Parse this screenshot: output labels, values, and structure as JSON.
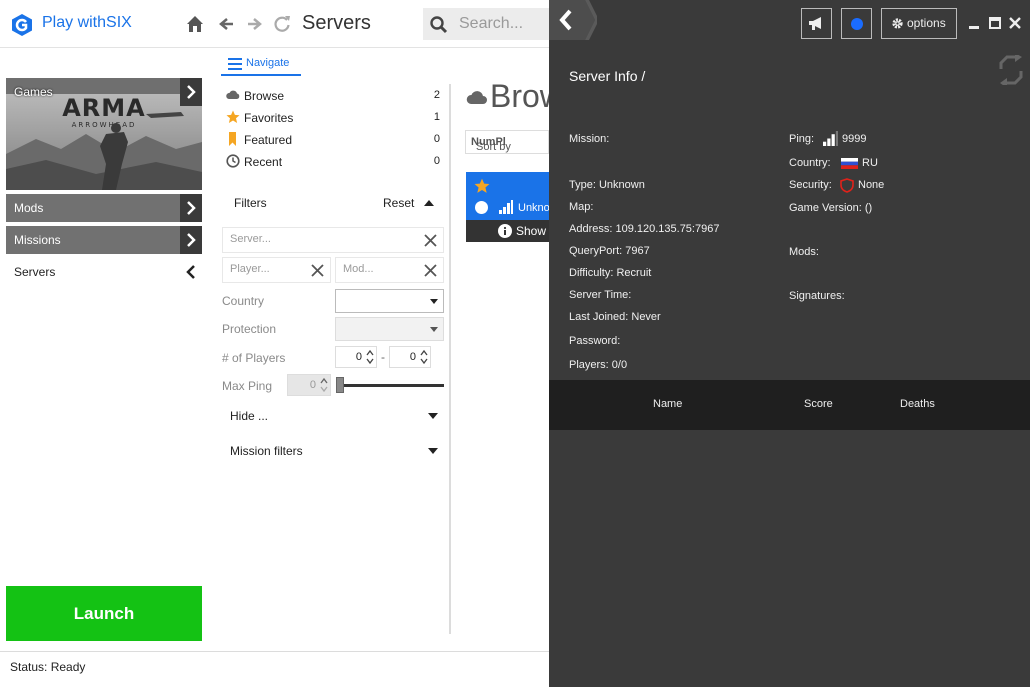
{
  "app": {
    "title": "Play withSIX"
  },
  "header": {
    "page_title": "Servers",
    "search_placeholder": "Search..."
  },
  "sidebar": {
    "items": [
      {
        "label": "Games"
      },
      {
        "label": "Mods"
      },
      {
        "label": "Missions"
      },
      {
        "label": "Servers"
      }
    ],
    "launch_label": "Launch"
  },
  "status": {
    "text": "Status: Ready"
  },
  "navigate": {
    "tab_label": "Navigate",
    "items": [
      {
        "label": "Browse",
        "count": "2"
      },
      {
        "label": "Favorites",
        "count": "1"
      },
      {
        "label": "Featured",
        "count": "0"
      },
      {
        "label": "Recent",
        "count": "0"
      }
    ]
  },
  "filters": {
    "title": "Filters",
    "reset_label": "Reset",
    "server_placeholder": "Server...",
    "player_placeholder": "Player...",
    "mod_placeholder": "Mod...",
    "country_label": "Country",
    "protection_label": "Protection",
    "players_label": "# of Players",
    "players_min": "0",
    "players_max": "0",
    "players_sep": "-",
    "ping_label": "Max Ping",
    "ping_value": "0",
    "ping_level": 0,
    "hide_label": "Hide ...",
    "mission_filters_label": "Mission filters"
  },
  "browse": {
    "title": "Brows",
    "sort_prefix": "Sort by ",
    "sort_value": "NumPl",
    "row_name": "Unkno",
    "show_label": "Show"
  },
  "panel": {
    "header": {
      "options_label": "options"
    },
    "title": "Server Info /",
    "left": {
      "mission": "Mission:",
      "type": "Type: Unknown",
      "map": "Map:",
      "address": "Address: 109.120.135.75:7967",
      "queryport": "QueryPort: 7967",
      "difficulty": "Difficulty: Recruit",
      "server_time": "Server Time:",
      "last_joined": "Last Joined: Never",
      "password": "Password:",
      "players": "Players: 0/0"
    },
    "right": {
      "ping_label": "Ping:",
      "ping_value": "9999",
      "country_label": "Country:",
      "country_value": "RU",
      "security_label": "Security:",
      "security_value": "None",
      "game_version": "Game Version:  ()",
      "mods": "Mods:",
      "signatures": "Signatures:"
    },
    "table": {
      "col_name": "Name",
      "col_score": "Score",
      "col_deaths": "Deaths"
    }
  },
  "colors": {
    "accent": "#1a73e8",
    "launch": "#14c214",
    "panel_bg": "#3a3a3a",
    "favorite_star": "#f5a623",
    "status_dot": "#1a6cff"
  },
  "icons": [
    "logo-icon",
    "home-icon",
    "back-icon",
    "forward-icon",
    "refresh-icon",
    "search-icon",
    "chevron-right-icon",
    "chevron-left-icon",
    "menu-icon",
    "cloud-icon",
    "star-icon",
    "bookmark-icon",
    "clock-icon",
    "close-icon",
    "caret-down-icon",
    "caret-up-icon",
    "signal-icon",
    "info-icon",
    "megaphone-icon",
    "gear-icon",
    "minimize-icon",
    "maximize-icon",
    "sync-icon",
    "flag-ru-icon",
    "shield-icon"
  ]
}
